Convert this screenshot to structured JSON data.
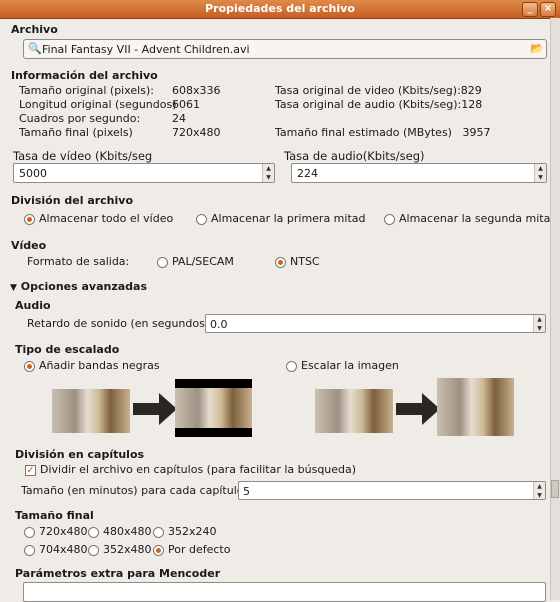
{
  "window": {
    "title": "Propiedades del archivo"
  },
  "archivo": {
    "label": "Archivo",
    "filename": "Final Fantasy VII - Advent Children.avi"
  },
  "info": {
    "label": "Información del archivo",
    "left": [
      {
        "k": "Tamaño original (pixels):",
        "v": "608x336"
      },
      {
        "k": "Longitud original (segundos)",
        "v": "6061"
      },
      {
        "k": "Cuadros por segundo:",
        "v": "24"
      },
      {
        "k": "Tamaño final (pixels)",
        "v": "720x480"
      }
    ],
    "right": [
      {
        "k": "Tasa original de video (Kbits/seg):",
        "v": "829"
      },
      {
        "k": "Tasa original de audio (Kbits/seg):",
        "v": "128"
      },
      {
        "k": "Tamaño final estimado (MBytes)",
        "v": "3957"
      }
    ]
  },
  "tasa_video": {
    "label": "Tasa de vídeo (Kbits/seg",
    "value": "5000"
  },
  "tasa_audio": {
    "label": "Tasa de audio(Kbits/seg)",
    "value": "224"
  },
  "division": {
    "label": "División del archivo",
    "options": [
      "Almacenar todo el vídeo",
      "Almacenar la primera mitad",
      "Almacenar la segunda mitad"
    ],
    "selected": 0
  },
  "video": {
    "label": "Vídeo",
    "formato_label": "Formato de salida:",
    "options": [
      "PAL/SECAM",
      "NTSC"
    ],
    "selected": 1
  },
  "avanzadas": {
    "label": "Opciones avanzadas"
  },
  "audio": {
    "label": "Audio",
    "retardo_label": "Retardo de sonido (en segundos):",
    "retardo_value": "0.0"
  },
  "escalado": {
    "label": "Tipo de escalado",
    "options": [
      "Añadir bandas negras",
      "Escalar la imagen"
    ],
    "selected": 0
  },
  "capitulos": {
    "label": "División en capítulos",
    "check_label": "Dividir el archivo en capítulos (para facilitar la búsqueda)",
    "checked": true,
    "size_label": "Tamaño (en minutos) para cada capítulo:",
    "size_value": "5"
  },
  "tamano_final": {
    "label": "Tamaño final",
    "options": [
      "720x480",
      "480x480",
      "352x240",
      "704x480",
      "352x480",
      "Por defecto"
    ],
    "selected": 5
  },
  "mencoder": {
    "label": "Parámetros extra para Mencoder"
  },
  "colors": {
    "accent": "#d4631d",
    "titlebar": "#c55f22",
    "bg": "#efebe7"
  }
}
